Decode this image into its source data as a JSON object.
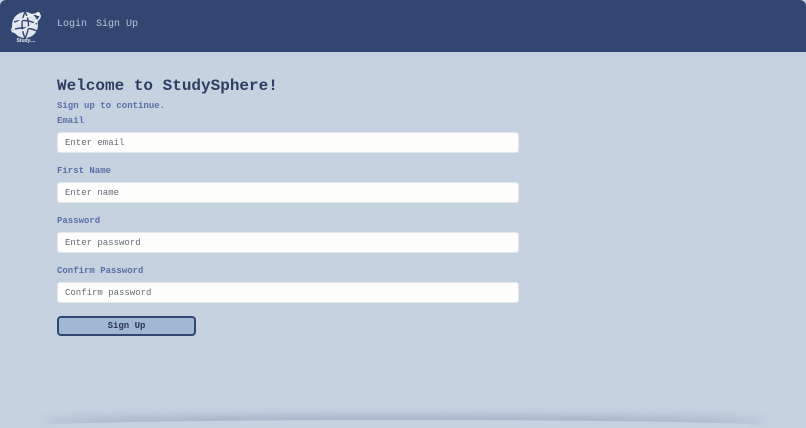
{
  "app": {
    "logo_text": "Study....",
    "logo_icon": "globe-orbit-icon"
  },
  "nav": {
    "login_label": "Login",
    "signup_label": "Sign Up"
  },
  "form": {
    "title": "Welcome to StudySphere!",
    "subtitle": "Sign up to continue.",
    "fields": {
      "email": {
        "label": "Email",
        "placeholder": "Enter email",
        "value": ""
      },
      "first_name": {
        "label": "First Name",
        "placeholder": "Enter name",
        "value": ""
      },
      "password": {
        "label": "Password",
        "placeholder": "Enter password",
        "value": ""
      },
      "confirm_password": {
        "label": "Confirm Password",
        "placeholder": "Confirm password",
        "value": ""
      }
    },
    "submit_label": "Sign Up"
  },
  "colors": {
    "navbar": "#334671",
    "background": "#c7d2e1",
    "accent_text": "#5a6fa8",
    "title_text": "#2f3e63",
    "button_fill": "#a0b8d3"
  }
}
